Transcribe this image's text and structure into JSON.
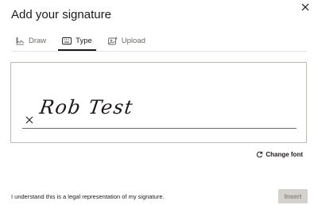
{
  "dialog": {
    "title": "Add your signature",
    "close_icon": "close-icon"
  },
  "tabs": [
    {
      "label": "Draw",
      "icon": "draw-icon",
      "active": false
    },
    {
      "label": "Type",
      "icon": "keyboard-icon",
      "active": true
    },
    {
      "label": "Upload",
      "icon": "upload-image-icon",
      "active": false
    }
  ],
  "signature": {
    "text": "Rob Test",
    "clear_icon": "clear-x-icon"
  },
  "change_font": {
    "label": "Change font",
    "icon": "refresh-icon"
  },
  "footer": {
    "disclaimer": "I understand this is a legal representation of my signature.",
    "insert_label": "Insert"
  },
  "colors": {
    "text": "#1e1919",
    "muted": "#6d6a67",
    "border": "#bbb7b2",
    "button_disabled_bg": "#d5d1cc",
    "button_disabled_text": "#8b8782"
  }
}
